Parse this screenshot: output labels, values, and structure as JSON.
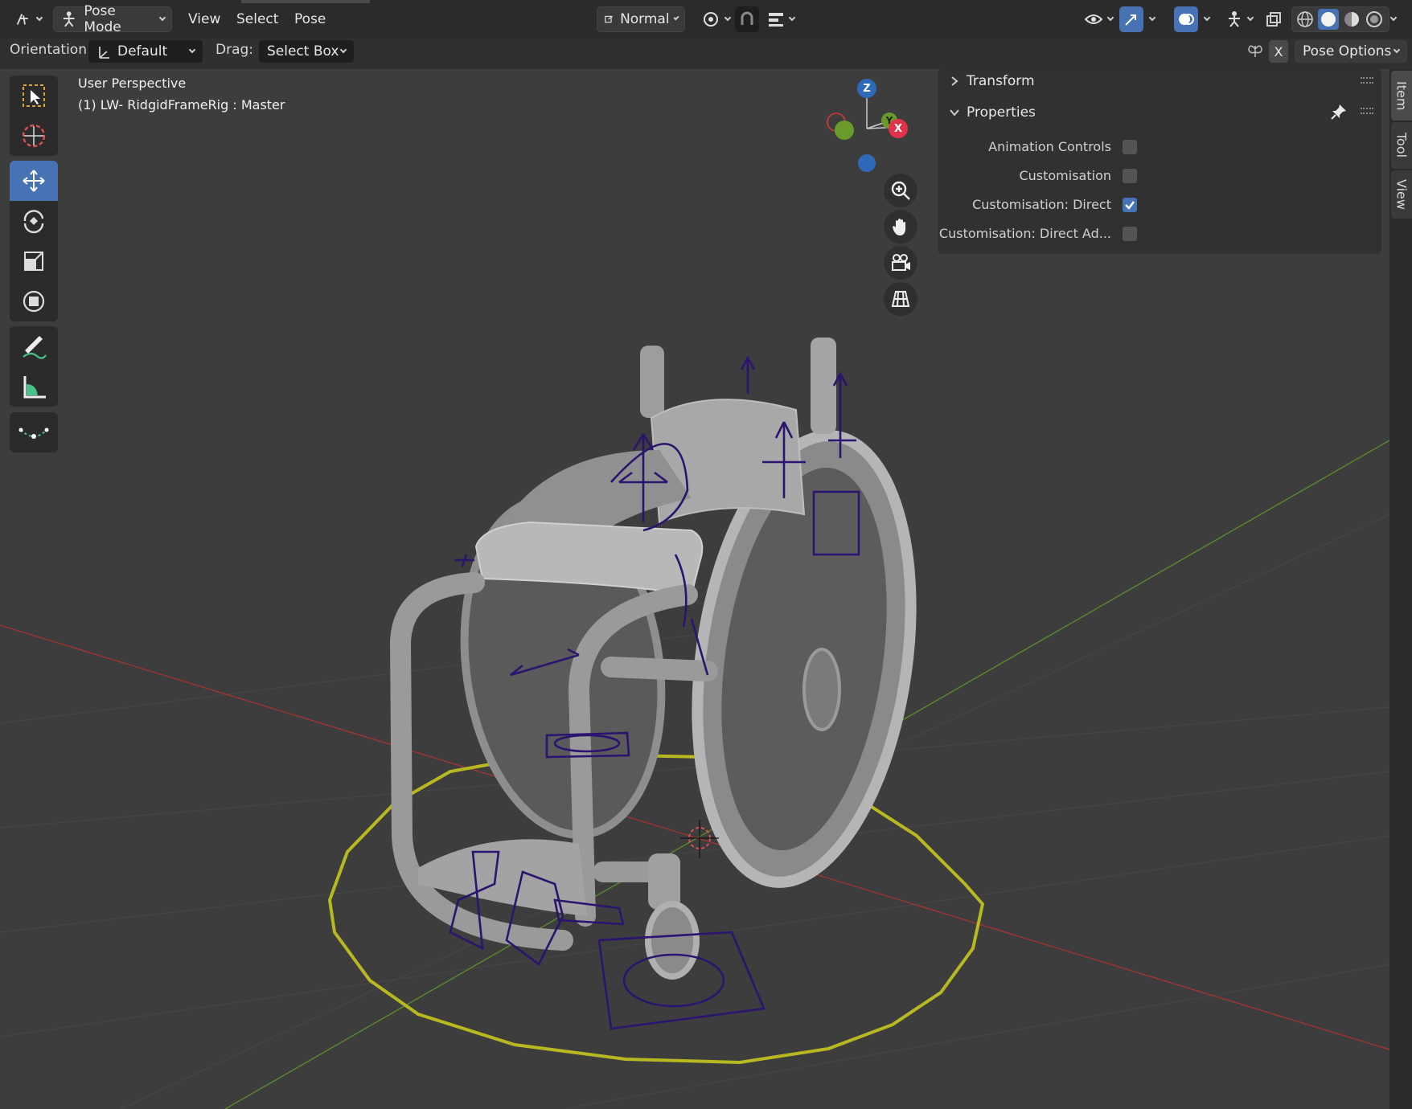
{
  "header": {
    "editor_type_icon": "pose-armature-icon",
    "mode": "Pose Mode",
    "menus": [
      "View",
      "Select",
      "Pose"
    ],
    "transform_orientation": "Normal",
    "pivot_icon": "pivot-icon",
    "snap_icon": "snap-magnet-icon",
    "proportional_icon": "proportional-icon",
    "visibility_icon": "eye-icon",
    "gizmo_icon": "gizmo-icon",
    "overlay_icon": "overlay-icon",
    "bone_overlay_icon": "bone-overlay-icon",
    "xray_icon": "xray-icon",
    "shading_modes": [
      "wireframe",
      "solid",
      "material",
      "rendered"
    ],
    "active_shading": "solid"
  },
  "tool_header": {
    "orientation_label": "Orientation:",
    "orientation_value": "Default",
    "drag_label": "Drag:",
    "drag_value": "Select Box",
    "x_mirror": "X",
    "pose_options": "Pose Options"
  },
  "viewport": {
    "perspective_label": "User Perspective",
    "object_label": "(1) LW- RidgidFrameRig : Master",
    "gizmo_axes": [
      "Z",
      "Y",
      "X"
    ],
    "nav_buttons": [
      "zoom-icon",
      "hand-pan-icon",
      "camera-icon",
      "grid-ortho-icon"
    ]
  },
  "toolbar_tools": [
    "select-box-icon",
    "cursor-icon",
    "move-icon",
    "rotate-icon",
    "scale-icon",
    "transform-icon",
    "annotate-icon",
    "measure-icon",
    "bend-curve-icon"
  ],
  "n_panel": {
    "sections": [
      {
        "title": "Transform",
        "expanded": false
      },
      {
        "title": "Properties",
        "expanded": true
      }
    ],
    "properties": [
      {
        "label": "Animation Controls",
        "checked": false
      },
      {
        "label": "Customisation",
        "checked": false
      },
      {
        "label": "Customisation: Direct",
        "checked": true
      },
      {
        "label": "Customisation: Direct Ad...",
        "checked": false
      }
    ]
  },
  "side_tabs": [
    "Item",
    "Tool",
    "View"
  ],
  "colors": {
    "accent": "#4772b3",
    "bone_wire": "#2a1470",
    "selection_ring": "#b8b820",
    "axis_x": "#a03535",
    "axis_y": "#5a8a2a"
  }
}
